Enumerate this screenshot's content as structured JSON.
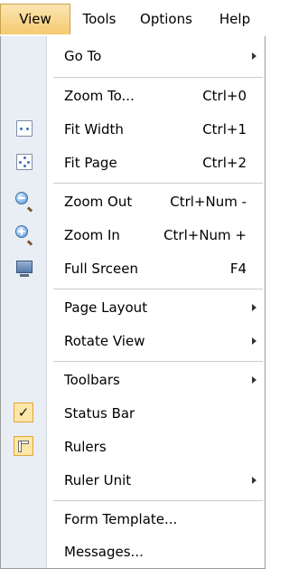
{
  "menubar": {
    "items": [
      {
        "label": "View",
        "active": true
      },
      {
        "label": "Tools",
        "active": false
      },
      {
        "label": "Options",
        "active": false
      },
      {
        "label": "Help",
        "active": false
      }
    ]
  },
  "menu": {
    "items": [
      {
        "label": "Go To",
        "submenu": true
      },
      {
        "label": "Zoom To...",
        "shortcut": "Ctrl+0"
      },
      {
        "label": "Fit Width",
        "shortcut": "Ctrl+1",
        "icon": "fit-width-icon"
      },
      {
        "label": "Fit Page",
        "shortcut": "Ctrl+2",
        "icon": "fit-page-icon"
      },
      {
        "label": "Zoom Out",
        "shortcut": "Ctrl+Num -",
        "icon": "zoom-out-icon"
      },
      {
        "label": "Zoom In",
        "shortcut": "Ctrl+Num +",
        "icon": "zoom-in-icon"
      },
      {
        "label": "Full Srceen",
        "shortcut": "F4",
        "icon": "full-screen-icon"
      },
      {
        "label": "Page Layout",
        "submenu": true
      },
      {
        "label": "Rotate View",
        "submenu": true
      },
      {
        "label": "Toolbars",
        "submenu": true
      },
      {
        "label": "Status Bar",
        "checked": true,
        "icon": "checkmark-icon"
      },
      {
        "label": "Rulers",
        "checked": true,
        "icon": "ruler-icon"
      },
      {
        "label": "Ruler Unit",
        "submenu": true
      },
      {
        "label": "Form Template..."
      },
      {
        "label": "Messages..."
      }
    ],
    "check_glyph": "✓"
  },
  "colors": {
    "active_menu_bg": "#f5c96f",
    "gutter": "#e9eef4",
    "check_bg": "#fce6a8",
    "check_border": "#e2a43b"
  }
}
